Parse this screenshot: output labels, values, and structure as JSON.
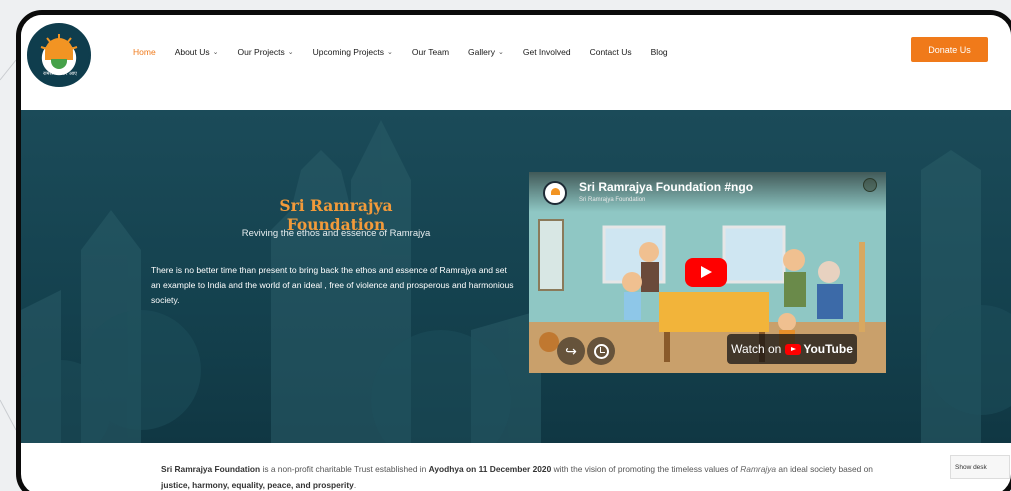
{
  "header": {
    "logo_alt": "Sri Ramrajya Foundation logo",
    "logo_motto": "रामराज्य फिर आए",
    "nav": [
      {
        "label": "Home",
        "active": true,
        "has_dropdown": false
      },
      {
        "label": "About Us",
        "active": false,
        "has_dropdown": true
      },
      {
        "label": "Our Projects",
        "active": false,
        "has_dropdown": true
      },
      {
        "label": "Upcoming Projects",
        "active": false,
        "has_dropdown": true
      },
      {
        "label": "Our Team",
        "active": false,
        "has_dropdown": false
      },
      {
        "label": "Gallery",
        "active": false,
        "has_dropdown": true
      },
      {
        "label": "Get Involved",
        "active": false,
        "has_dropdown": false
      },
      {
        "label": "Contact Us",
        "active": false,
        "has_dropdown": false
      },
      {
        "label": "Blog",
        "active": false,
        "has_dropdown": false
      }
    ],
    "donate_label": "Donate Us"
  },
  "hero": {
    "title": "Sri Ramrajya Foundation",
    "subtitle": "Reviving the ethos and essence of Ramrajya",
    "body": "There is no better time than present to bring back the ethos and essence of Ramrajya and set an example to India and the world  of an ideal , free of violence  and prosperous and harmonious society."
  },
  "video": {
    "title": "Sri Ramrajya Foundation #ngo",
    "channel": "Sri Ramrajya Foundation",
    "watch_on": "Watch on",
    "youtube": "YouTube"
  },
  "intro": {
    "org": "Sri Ramrajya Foundation",
    "t1": " is a non-profit charitable Trust established in ",
    "place_date": "Ayodhya on 11 December 2020",
    "t2": " with the vision of promoting the timeless values of ",
    "ramrajya": "Ramrajya",
    "t3": " an ideal society based on ",
    "values": "justice, harmony, equality, peace, and prosperity",
    "t4": "."
  },
  "show_desktop": "Show desk",
  "colors": {
    "accent": "#f07a1a",
    "hero_bg": "#1b4b59",
    "title_orange": "#f29a3a",
    "frame": "#0b0b0b"
  }
}
